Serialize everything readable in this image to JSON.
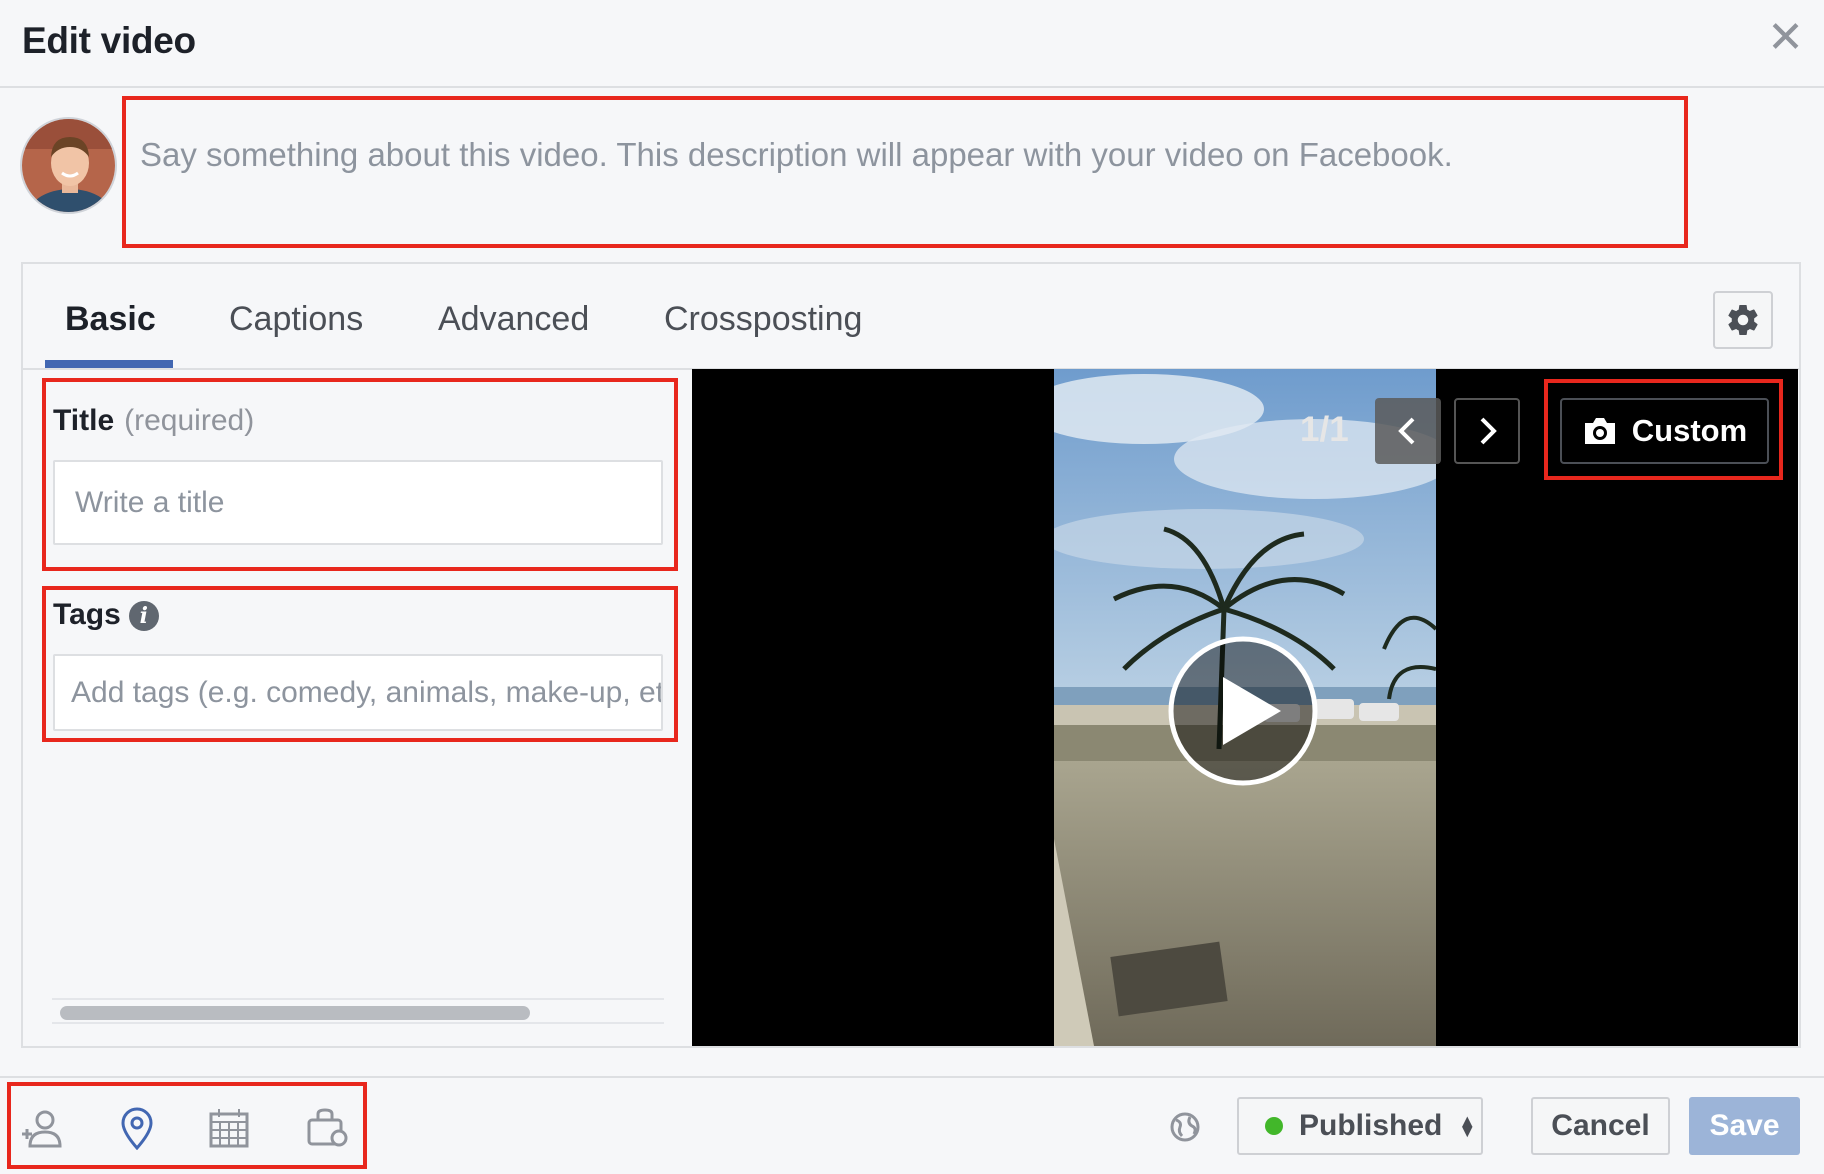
{
  "header": {
    "title": "Edit video",
    "close_icon": "close-icon"
  },
  "composer": {
    "placeholder": "Say something about this video. This description will appear with your video on Facebook."
  },
  "tabs": [
    {
      "label": "Basic",
      "active": true
    },
    {
      "label": "Captions",
      "active": false
    },
    {
      "label": "Advanced",
      "active": false
    },
    {
      "label": "Crossposting",
      "active": false
    }
  ],
  "form": {
    "title_label": "Title",
    "title_sub": "(required)",
    "title_placeholder": "Write a title",
    "tags_label": "Tags",
    "tags_info_glyph": "i",
    "tags_placeholder": "Add tags (e.g. comedy, animals, make-up, etc.)"
  },
  "thumbnail": {
    "counter": "1/1",
    "custom_label": "Custom"
  },
  "footer": {
    "tools": [
      "tag-people-icon",
      "location-pin-icon",
      "calendar-icon",
      "feeling-bag-icon"
    ],
    "status_label": "Published",
    "status_color": "#42b72a",
    "cancel_label": "Cancel",
    "save_label": "Save"
  },
  "colors": {
    "accent": "#4267b2",
    "highlight": "#e8271d",
    "save_disabled": "#9cb4d8"
  }
}
